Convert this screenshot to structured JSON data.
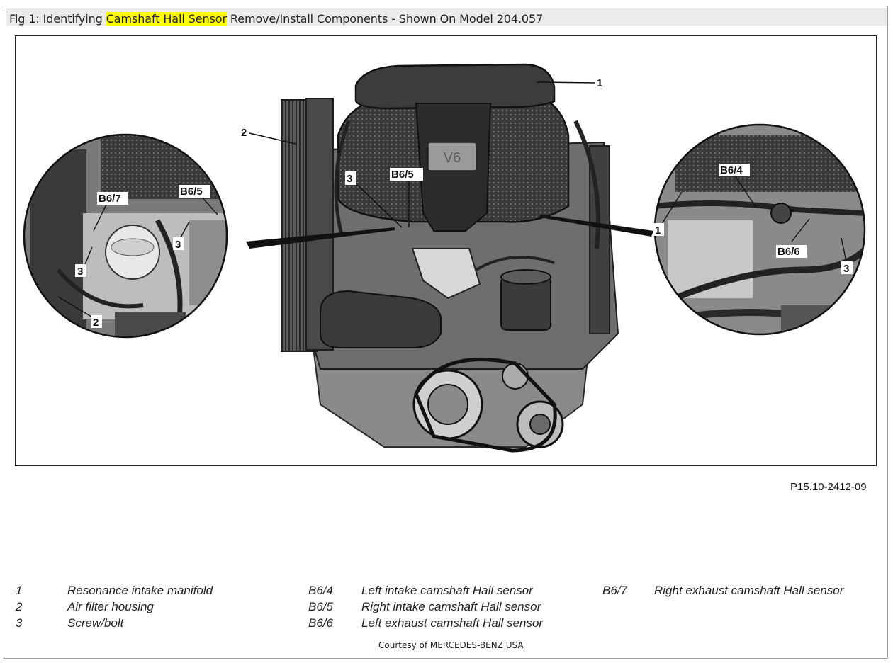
{
  "caption": {
    "prefix": "Fig 1: Identifying ",
    "highlight": "Camshaft Hall Sensor",
    "suffix": " Remove/Install Components - Shown On Model 204.057"
  },
  "figure": {
    "code": "P15.10-2412-09",
    "callouts": {
      "c1": "1",
      "c2": "2",
      "c3": "3",
      "c4": "B6/5",
      "left_b67": "B6/7",
      "left_b65": "B6/5",
      "left_3a": "3",
      "left_3b": "3",
      "left_2": "2",
      "right_b64": "B6/4",
      "right_1": "1",
      "right_b66": "B6/6",
      "right_3": "3"
    },
    "badge": "V6"
  },
  "legend": [
    {
      "key": "1",
      "text": "Resonance intake manifold"
    },
    {
      "key": "2",
      "text": "Air filter housing"
    },
    {
      "key": "3",
      "text": "Screw/bolt"
    },
    {
      "key": "B6/4",
      "text": "Left intake camshaft Hall sensor"
    },
    {
      "key": "B6/5",
      "text": "Right intake camshaft Hall sensor"
    },
    {
      "key": "B6/6",
      "text": "Left exhaust camshaft Hall sensor"
    },
    {
      "key": "B6/7",
      "text": "Right exhaust camshaft Hall sensor"
    }
  ],
  "courtesy": "Courtesy of MERCEDES-BENZ USA",
  "colors": {
    "highlight": "#ffff00",
    "engine_dark": "#2d2d2d",
    "engine_mid": "#5a5a5a",
    "engine_light": "#9c9c9c"
  }
}
